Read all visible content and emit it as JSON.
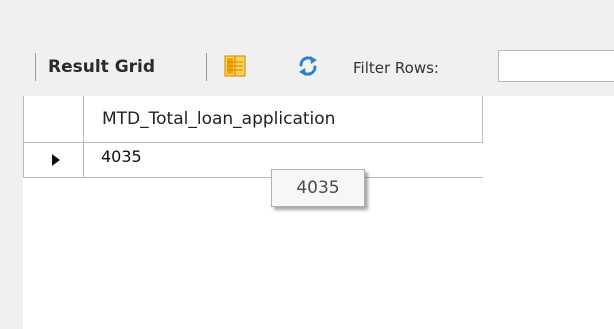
{
  "toolbar": {
    "result_grid_label": "Result Grid",
    "filter_label": "Filter Rows:",
    "filter_value": "",
    "icons": {
      "grid_form": "grid-form-icon",
      "refresh": "refresh-icon"
    }
  },
  "grid": {
    "columns": [
      "MTD_Total_loan_application"
    ],
    "rows": [
      [
        "4035"
      ]
    ]
  },
  "tooltip": {
    "text": "4035"
  },
  "colors": {
    "toolbar_bg": "#f0f0f0",
    "grid_line": "#bcbcbc",
    "refresh_blue": "#2f7fd1",
    "grid_icon_orange": "#f2a400"
  }
}
